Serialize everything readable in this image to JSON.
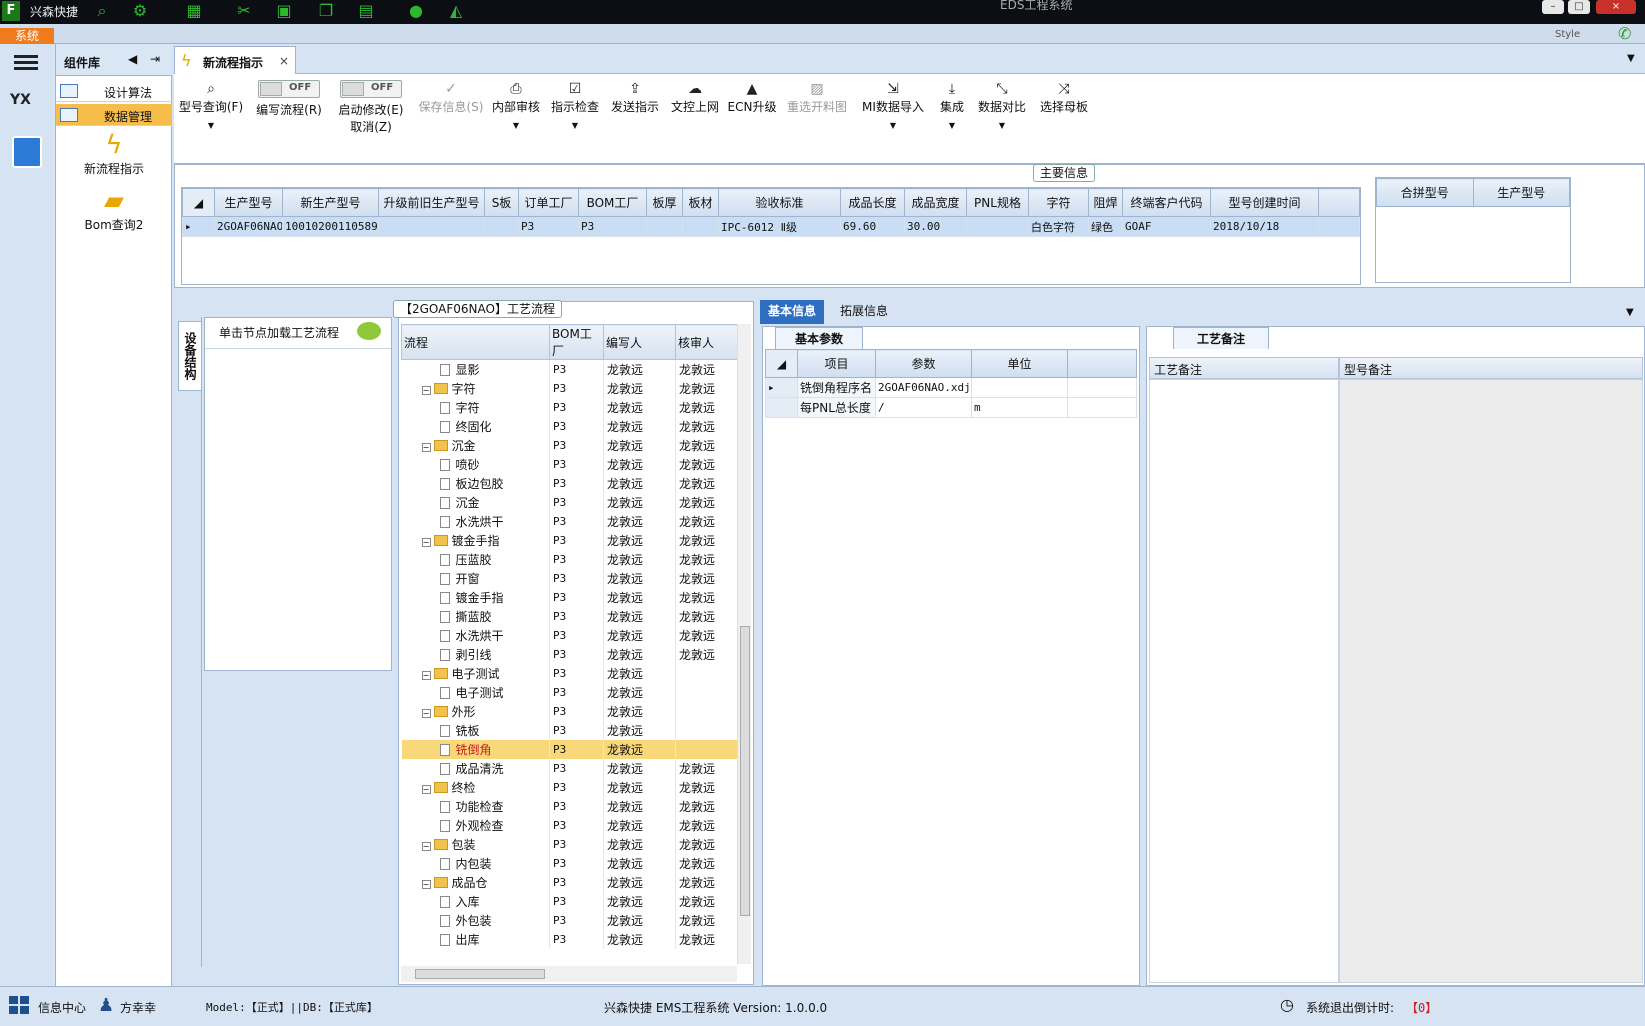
{
  "app": {
    "brand": "兴森快捷",
    "window_title": "EDS工程系统",
    "system_tab": "系统",
    "style_label": "Style"
  },
  "component_panel": {
    "title": "组件库",
    "items": [
      {
        "label": "设计算法",
        "selected": false
      },
      {
        "label": "数据管理",
        "selected": true
      }
    ],
    "tools": [
      {
        "label": "新流程指示",
        "icon": "lightning-icon"
      },
      {
        "label": "Bom查询2",
        "icon": "folder-icon"
      }
    ]
  },
  "doc_tab": {
    "label": "新流程指示",
    "close": "×"
  },
  "ribbon": {
    "model_query": "型号查询(F)",
    "write_flow": "编写流程(R)",
    "write_flow_toggle": "OFF",
    "enable_edit": "启动修改(E)",
    "cancel": "取消(Z)",
    "enable_edit_toggle": "OFF",
    "save_info": "保存信息(S)",
    "internal_review": "内部审核",
    "instruction_check": "指示检查",
    "send_instruction": "发送指示",
    "file_upload": "文控上网",
    "ecn_upgrade": "ECN升级",
    "reselect_material": "重选开料图",
    "mi_import": "MI数据导入",
    "integrate": "集成",
    "data_compare": "数据对比",
    "select_master": "选择母板"
  },
  "main_info": {
    "title": "主要信息",
    "columns": [
      "生产型号",
      "新生产型号",
      "升级前旧生产型号",
      "S板",
      "订单工厂",
      "BOM工厂",
      "板厚",
      "板材",
      "验收标准",
      "成品长度",
      "成品宽度",
      "PNL规格",
      "字符",
      "阻焊",
      "终端客户代码",
      "型号创建时间"
    ],
    "rows": [
      [
        "2GOAF06NAO",
        "10010200110589",
        "",
        "",
        "P3",
        "P3",
        "",
        "",
        "IPC-6012 Ⅱ级",
        "69.60",
        "30.00",
        "",
        "白色字符",
        "绿色",
        "GOAF",
        "2018/10/18"
      ]
    ],
    "side_columns": [
      "合拼型号",
      "生产型号"
    ]
  },
  "equipment_tab": "设备结构",
  "node_hint": "单击节点加载工艺流程",
  "process": {
    "caption": "【2GOAF06NAO】工艺流程",
    "columns": [
      "流程",
      "BOM工厂",
      "编写人",
      "核审人"
    ],
    "rows": [
      {
        "level": 1,
        "type": "leaf",
        "name": "显影",
        "bom": "P3",
        "writer": "龙敦远",
        "reviewer": "龙敦远"
      },
      {
        "level": 0,
        "type": "folder",
        "name": "字符",
        "bom": "P3",
        "writer": "龙敦远",
        "reviewer": "龙敦远"
      },
      {
        "level": 1,
        "type": "leaf",
        "name": "字符",
        "bom": "P3",
        "writer": "龙敦远",
        "reviewer": "龙敦远"
      },
      {
        "level": 1,
        "type": "leaf",
        "name": "终固化",
        "bom": "P3",
        "writer": "龙敦远",
        "reviewer": "龙敦远"
      },
      {
        "level": 0,
        "type": "folder",
        "name": "沉金",
        "bom": "P3",
        "writer": "龙敦远",
        "reviewer": "龙敦远"
      },
      {
        "level": 1,
        "type": "leaf",
        "name": "喷砂",
        "bom": "P3",
        "writer": "龙敦远",
        "reviewer": "龙敦远"
      },
      {
        "level": 1,
        "type": "leaf",
        "name": "板边包胶",
        "bom": "P3",
        "writer": "龙敦远",
        "reviewer": "龙敦远"
      },
      {
        "level": 1,
        "type": "leaf",
        "name": "沉金",
        "bom": "P3",
        "writer": "龙敦远",
        "reviewer": "龙敦远"
      },
      {
        "level": 1,
        "type": "leaf",
        "name": "水洗烘干",
        "bom": "P3",
        "writer": "龙敦远",
        "reviewer": "龙敦远"
      },
      {
        "level": 0,
        "type": "folder",
        "name": "镀金手指",
        "bom": "P3",
        "writer": "龙敦远",
        "reviewer": "龙敦远"
      },
      {
        "level": 1,
        "type": "leaf",
        "name": "压蓝胶",
        "bom": "P3",
        "writer": "龙敦远",
        "reviewer": "龙敦远"
      },
      {
        "level": 1,
        "type": "leaf",
        "name": "开窗",
        "bom": "P3",
        "writer": "龙敦远",
        "reviewer": "龙敦远"
      },
      {
        "level": 1,
        "type": "leaf",
        "name": "镀金手指",
        "bom": "P3",
        "writer": "龙敦远",
        "reviewer": "龙敦远"
      },
      {
        "level": 1,
        "type": "leaf",
        "name": "撕蓝胶",
        "bom": "P3",
        "writer": "龙敦远",
        "reviewer": "龙敦远"
      },
      {
        "level": 1,
        "type": "leaf",
        "name": "水洗烘干",
        "bom": "P3",
        "writer": "龙敦远",
        "reviewer": "龙敦远"
      },
      {
        "level": 1,
        "type": "leaf",
        "name": "剥引线",
        "bom": "P3",
        "writer": "龙敦远",
        "reviewer": "龙敦远"
      },
      {
        "level": 0,
        "type": "folder",
        "name": "电子测试",
        "bom": "P3",
        "writer": "龙敦远",
        "reviewer": ""
      },
      {
        "level": 1,
        "type": "leaf",
        "name": "电子测试",
        "bom": "P3",
        "writer": "龙敦远",
        "reviewer": ""
      },
      {
        "level": 0,
        "type": "folder",
        "name": "外形",
        "bom": "P3",
        "writer": "龙敦远",
        "reviewer": ""
      },
      {
        "level": 1,
        "type": "leaf",
        "name": "铣板",
        "bom": "P3",
        "writer": "龙敦远",
        "reviewer": ""
      },
      {
        "level": 1,
        "type": "leaf",
        "name": "铣倒角",
        "bom": "P3",
        "writer": "龙敦远",
        "reviewer": "",
        "selected": true
      },
      {
        "level": 1,
        "type": "leaf",
        "name": "成品清洗",
        "bom": "P3",
        "writer": "龙敦远",
        "reviewer": "龙敦远"
      },
      {
        "level": 0,
        "type": "folder",
        "name": "终检",
        "bom": "P3",
        "writer": "龙敦远",
        "reviewer": "龙敦远"
      },
      {
        "level": 1,
        "type": "leaf",
        "name": "功能检查",
        "bom": "P3",
        "writer": "龙敦远",
        "reviewer": "龙敦远"
      },
      {
        "level": 1,
        "type": "leaf",
        "name": "外观检查",
        "bom": "P3",
        "writer": "龙敦远",
        "reviewer": "龙敦远"
      },
      {
        "level": 0,
        "type": "folder",
        "name": "包装",
        "bom": "P3",
        "writer": "龙敦远",
        "reviewer": "龙敦远"
      },
      {
        "level": 1,
        "type": "leaf",
        "name": "内包装",
        "bom": "P3",
        "writer": "龙敦远",
        "reviewer": "龙敦远"
      },
      {
        "level": 0,
        "type": "folder",
        "name": "成品仓",
        "bom": "P3",
        "writer": "龙敦远",
        "reviewer": "龙敦远"
      },
      {
        "level": 1,
        "type": "leaf",
        "name": "入库",
        "bom": "P3",
        "writer": "龙敦远",
        "reviewer": "龙敦远"
      },
      {
        "level": 1,
        "type": "leaf",
        "name": "外包装",
        "bom": "P3",
        "writer": "龙敦远",
        "reviewer": "龙敦远"
      },
      {
        "level": 1,
        "type": "leaf",
        "name": "出库",
        "bom": "P3",
        "writer": "龙敦远",
        "reviewer": "龙敦远"
      }
    ]
  },
  "info_tabs": [
    {
      "label": "基本信息",
      "active": true
    },
    {
      "label": "拓展信息",
      "active": false
    }
  ],
  "params": {
    "tab": "基本参数",
    "columns": [
      "项目",
      "参数",
      "单位"
    ],
    "rows": [
      [
        "铣倒角程序名",
        "2GOAF06NAO.xdj",
        ""
      ],
      [
        "每PNL总长度",
        "/",
        "m"
      ]
    ]
  },
  "notes": {
    "tab": "工艺备注",
    "col_process": "工艺备注",
    "col_model": "型号备注"
  },
  "status": {
    "info_center": "信息中心",
    "user": "方幸幸",
    "model_db": "Model:【正式】||DB:【正式库】",
    "system_name": "兴森快捷 EMS工程系统 Version: 1.0.0.0",
    "logout_label": "系统退出倒计时:",
    "logout_value": "【0】"
  },
  "colors": {
    "accent": "#2e6fc2",
    "selected": "#f7bd4a",
    "system_tab": "#f07a1e",
    "highlight_row": "#f9d87a"
  }
}
